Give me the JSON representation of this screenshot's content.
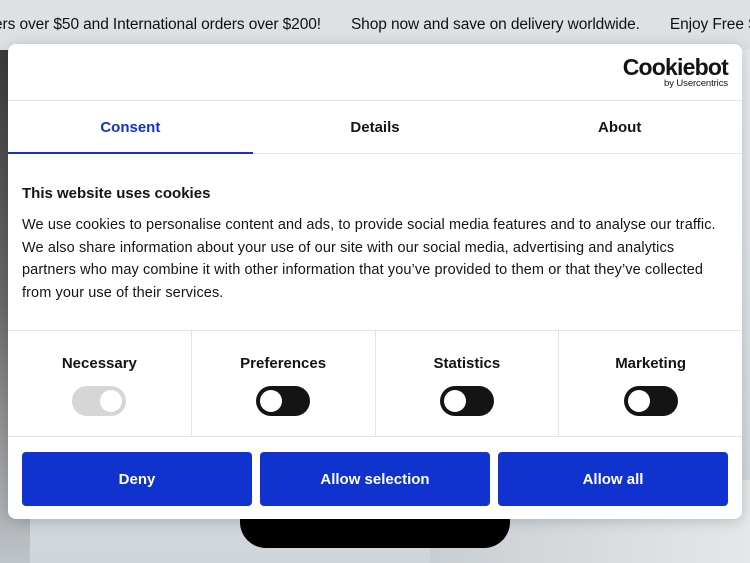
{
  "announcement": {
    "messages": [
      "ers over $50 and International orders over $200!",
      "Shop now and save on delivery worldwide.",
      "Enjoy Free Shipp"
    ]
  },
  "cookie_dialog": {
    "logo": {
      "name": "Cookiebot",
      "tagline": "by Usercentrics"
    },
    "tabs": [
      {
        "label": "Consent",
        "active": true
      },
      {
        "label": "Details",
        "active": false
      },
      {
        "label": "About",
        "active": false
      }
    ],
    "title": "This website uses cookies",
    "description": "We use cookies to personalise content and ads, to provide social media features and to analyse our traffic. We also share information about your use of our site with our social media, advertising and analytics partners who may combine it with other information that you’ve provided to them or that they’ve collected from your use of their services.",
    "categories": [
      {
        "label": "Necessary",
        "enabled": true,
        "locked": true
      },
      {
        "label": "Preferences",
        "enabled": false,
        "locked": false
      },
      {
        "label": "Statistics",
        "enabled": false,
        "locked": false
      },
      {
        "label": "Marketing",
        "enabled": false,
        "locked": false
      }
    ],
    "buttons": {
      "deny": "Deny",
      "allow_selection": "Allow selection",
      "allow_all": "Allow all"
    },
    "accent_color": "#1032cf"
  }
}
